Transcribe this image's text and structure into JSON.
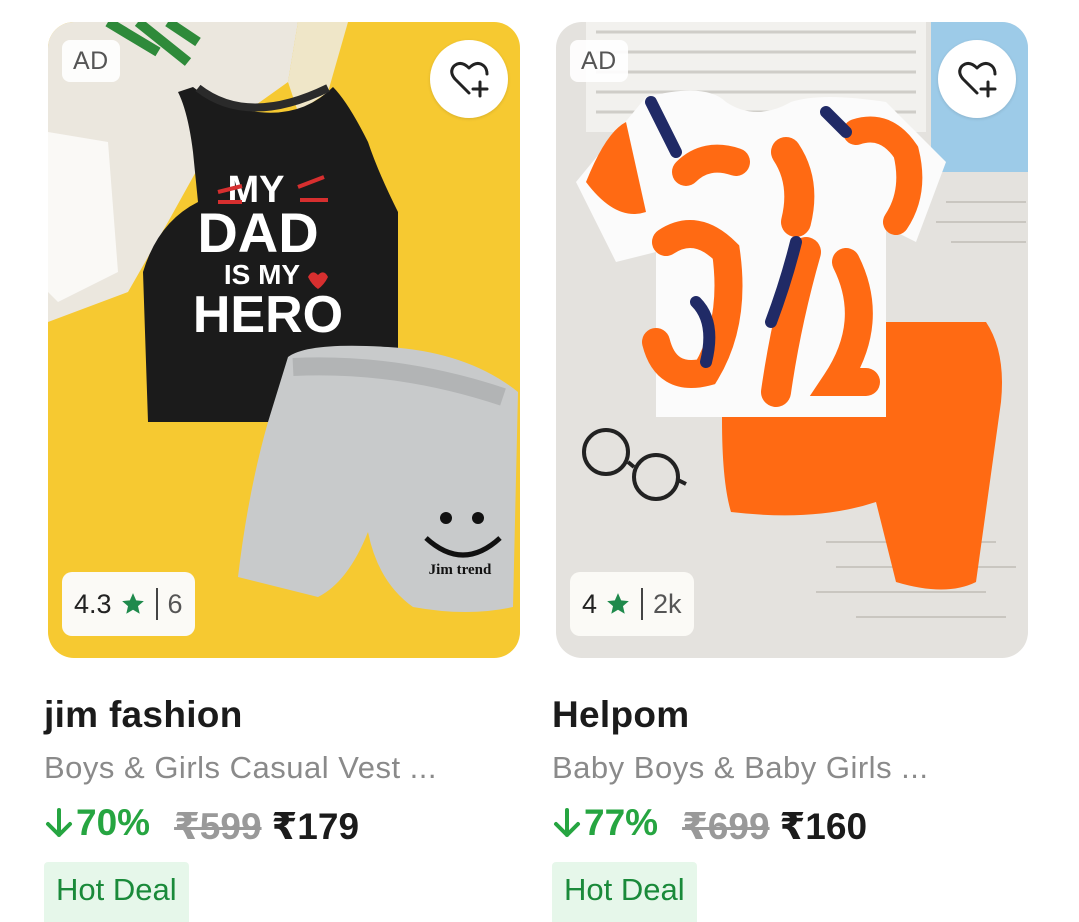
{
  "products": [
    {
      "ad_label": "AD",
      "rating": "4.3",
      "rating_count": "6",
      "brand": "jim fashion",
      "description": "Boys & Girls Casual Vest ...",
      "discount": "70%",
      "mrp": "₹599",
      "price": "₹179",
      "badge": "Hot Deal",
      "print_text": {
        "line1": "MY",
        "line2": "DAD",
        "line3": "IS MY",
        "line4": "HERO",
        "shorts_text": "Jim trend"
      }
    },
    {
      "ad_label": "AD",
      "rating": "4",
      "rating_count": "2k",
      "brand": "Helpom",
      "description": "Baby Boys & Baby Girls ...",
      "discount": "77%",
      "mrp": "₹699",
      "price": "₹160",
      "badge": "Hot Deal"
    }
  ],
  "icons": {
    "wishlist": "heart-plus-icon",
    "rating": "star-icon",
    "discount": "arrow-down-icon"
  },
  "colors": {
    "discount_green": "#26a541",
    "star_green": "#1f8a4c",
    "deal_bg": "#e6f7ea",
    "deal_text": "#1a8a3a"
  }
}
